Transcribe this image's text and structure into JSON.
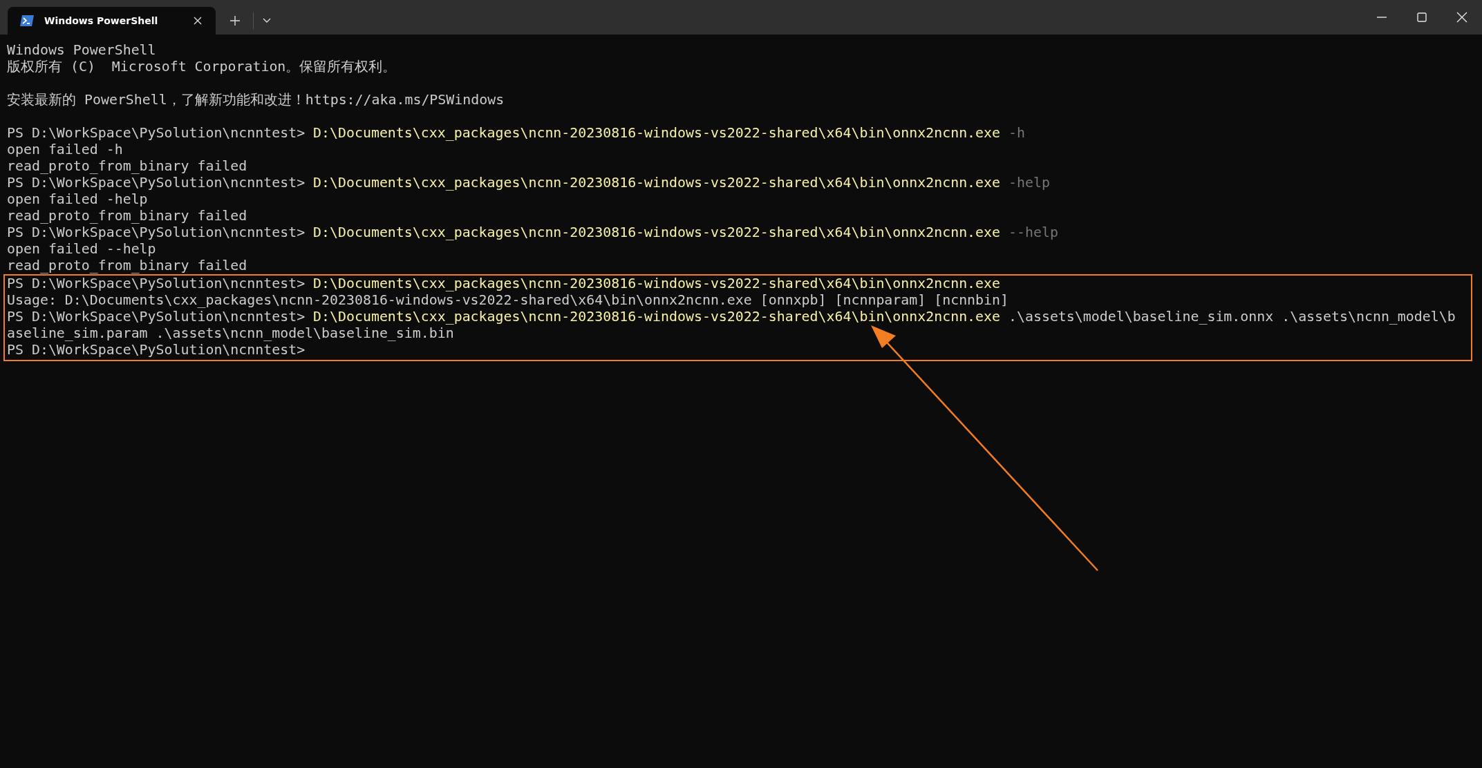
{
  "tab": {
    "title": "Windows PowerShell",
    "selected": true
  },
  "lines": [
    {
      "kind": "text",
      "segments": [
        {
          "kind": "output",
          "text": "Windows PowerShell"
        }
      ]
    },
    {
      "kind": "text",
      "segments": [
        {
          "kind": "output",
          "text": "版权所有 (C)  Microsoft Corporation。保留所有权利。"
        }
      ]
    },
    {
      "kind": "blank"
    },
    {
      "kind": "text",
      "segments": [
        {
          "kind": "output",
          "text": "安装最新的 PowerShell，了解新功能和改进！https://aka.ms/PSWindows"
        }
      ]
    },
    {
      "kind": "blank"
    },
    {
      "kind": "text",
      "segments": [
        {
          "kind": "prompt",
          "text": "PS D:\\WorkSpace\\PySolution\\ncnntest>"
        },
        {
          "kind": "command",
          "text": "D:\\Documents\\cxx_packages\\ncnn-20230816-windows-vs2022-shared\\x64\\bin\\onnx2ncnn.exe"
        },
        {
          "kind": "parameter",
          "text": "-h"
        }
      ]
    },
    {
      "kind": "text",
      "segments": [
        {
          "kind": "output",
          "text": "open failed -h"
        }
      ]
    },
    {
      "kind": "text",
      "segments": [
        {
          "kind": "output",
          "text": "read_proto_from_binary failed"
        }
      ]
    },
    {
      "kind": "text",
      "segments": [
        {
          "kind": "prompt",
          "text": "PS D:\\WorkSpace\\PySolution\\ncnntest>"
        },
        {
          "kind": "command",
          "text": "D:\\Documents\\cxx_packages\\ncnn-20230816-windows-vs2022-shared\\x64\\bin\\onnx2ncnn.exe"
        },
        {
          "kind": "parameter",
          "text": "-help"
        }
      ]
    },
    {
      "kind": "text",
      "segments": [
        {
          "kind": "output",
          "text": "open failed -help"
        }
      ]
    },
    {
      "kind": "text",
      "segments": [
        {
          "kind": "output",
          "text": "read_proto_from_binary failed"
        }
      ]
    },
    {
      "kind": "text",
      "segments": [
        {
          "kind": "prompt",
          "text": "PS D:\\WorkSpace\\PySolution\\ncnntest>"
        },
        {
          "kind": "command",
          "text": "D:\\Documents\\cxx_packages\\ncnn-20230816-windows-vs2022-shared\\x64\\bin\\onnx2ncnn.exe"
        },
        {
          "kind": "parameter",
          "text": "--help"
        }
      ]
    },
    {
      "kind": "text",
      "segments": [
        {
          "kind": "output",
          "text": "open failed --help"
        }
      ]
    },
    {
      "kind": "text",
      "segments": [
        {
          "kind": "output",
          "text": "read_proto_from_binary failed"
        }
      ]
    }
  ],
  "highlight_box": {
    "lines": [
      {
        "kind": "text",
        "segments": [
          {
            "kind": "prompt",
            "text": "PS D:\\WorkSpace\\PySolution\\ncnntest>"
          },
          {
            "kind": "command",
            "text": "D:\\Documents\\cxx_packages\\ncnn-20230816-windows-vs2022-shared\\x64\\bin\\onnx2ncnn.exe"
          }
        ]
      },
      {
        "kind": "text",
        "segments": [
          {
            "kind": "output",
            "text": "Usage: D:\\Documents\\cxx_packages\\ncnn-20230816-windows-vs2022-shared\\x64\\bin\\onnx2ncnn.exe [onnxpb] [ncnnparam] [ncnnbin]"
          }
        ]
      },
      {
        "kind": "text",
        "segments": [
          {
            "kind": "prompt",
            "text": "PS D:\\WorkSpace\\PySolution\\ncnntest>"
          },
          {
            "kind": "command",
            "text": "D:\\Documents\\cxx_packages\\ncnn-20230816-windows-vs2022-shared\\x64\\bin\\onnx2ncnn.exe"
          },
          {
            "kind": "argument",
            "text": ".\\assets\\model\\baseline_sim.onnx"
          },
          {
            "kind": "argument",
            "text": ".\\assets\\ncnn_model\\b"
          }
        ]
      },
      {
        "kind": "text",
        "segments": [
          {
            "kind": "argument",
            "text": "aseline_sim.param"
          },
          {
            "kind": "argument",
            "text": ".\\assets\\ncnn_model\\baseline_sim.bin"
          }
        ]
      },
      {
        "kind": "text",
        "segments": [
          {
            "kind": "prompt",
            "text": "PS D:\\WorkSpace\\PySolution\\ncnntest>"
          }
        ]
      }
    ]
  }
}
